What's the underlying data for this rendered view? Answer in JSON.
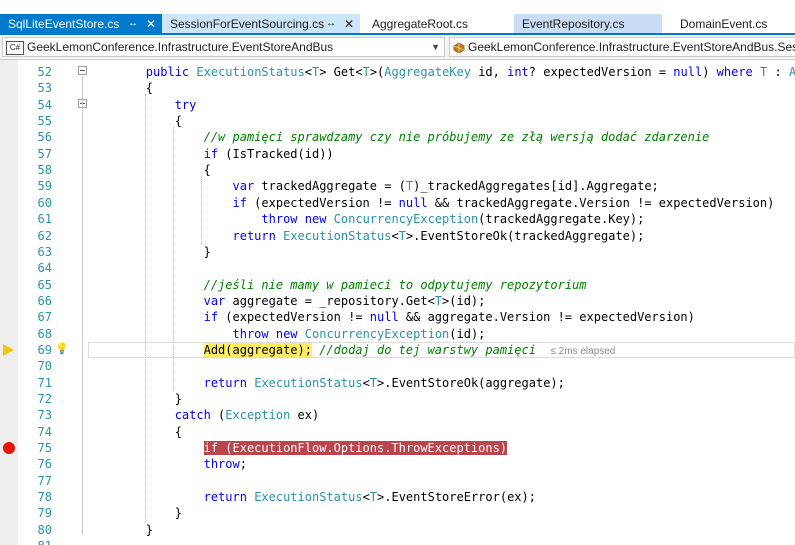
{
  "tabs": [
    {
      "label": "SqlLiteEventStore.cs",
      "pin": "↔",
      "close": "✕"
    },
    {
      "label": "SessionForEventSourcing.cs",
      "pin": "↔",
      "close": "✕"
    },
    {
      "label": "AggregateRoot.cs"
    },
    {
      "label": "EventRepository.cs"
    },
    {
      "label": "DomainEvent.cs"
    }
  ],
  "nav": {
    "project": "GeekLemonConference.Infrastructure.EventStoreAndBus",
    "project_badge": "C#",
    "type_scope": "GeekLemonConference.Infrastructure.EventStoreAndBus.Sessio"
  },
  "elapsed": "≤ 2ms elapsed",
  "lines": [
    {
      "n": "52",
      "html": "        <span class=\"kw\">public</span> <span class=\"ty\">ExecutionStatus</span>&lt;<span class=\"ty\">T</span>&gt; Get&lt;<span class=\"ty\">T</span>&gt;(<span class=\"ty\">AggregateKey</span> id, <span class=\"kw\">int</span>? expectedVersion = <span class=\"kw\">null</span>) <span class=\"kw\">where</span> <span class=\"ty\">T</span> : <span class=\"ty\">Aggreg</span>"
    },
    {
      "n": "53",
      "html": "        {"
    },
    {
      "n": "54",
      "html": "            <span class=\"kw\">try</span>"
    },
    {
      "n": "55",
      "html": "            {"
    },
    {
      "n": "56",
      "html": "                <span class=\"cm\">//w pamięci sprawdzamy czy nie próbujemy ze złą wersją dodać zdarzenie</span>"
    },
    {
      "n": "57",
      "html": "                <span class=\"kw\">if</span> (IsTracked(id))"
    },
    {
      "n": "58",
      "html": "                {"
    },
    {
      "n": "59",
      "html": "                    <span class=\"kw\">var</span> trackedAggregate = (<span class=\"ty\">T</span>)_trackedAggregates[id].Aggregate;"
    },
    {
      "n": "60",
      "html": "                    <span class=\"kw\">if</span> (expectedVersion != <span class=\"kw\">null</span> &amp;&amp; trackedAggregate.Version != expectedVersion)"
    },
    {
      "n": "61",
      "html": "                        <span class=\"kw\">throw</span> <span class=\"kw\">new</span> <span class=\"ty\">ConcurrencyException</span>(trackedAggregate.Key);"
    },
    {
      "n": "62",
      "html": "                    <span class=\"kw\">return</span> <span class=\"ty\">ExecutionStatus</span>&lt;<span class=\"ty\">T</span>&gt;.EventStoreOk(trackedAggregate);"
    },
    {
      "n": "63",
      "html": "                }"
    },
    {
      "n": "64",
      "html": ""
    },
    {
      "n": "65",
      "html": "                <span class=\"cm\">//jeśli nie mamy w pamieci to odpytujemy repozytorium</span>"
    },
    {
      "n": "66",
      "html": "                <span class=\"kw\">var</span> aggregate = _repository.Get&lt;<span class=\"ty\">T</span>&gt;(id);"
    },
    {
      "n": "67",
      "html": "                <span class=\"kw\">if</span> (expectedVersion != <span class=\"kw\">null</span> &amp;&amp; aggregate.Version != expectedVersion)"
    },
    {
      "n": "68",
      "html": "                    <span class=\"kw\">throw</span> <span class=\"kw\">new</span> <span class=\"ty\">ConcurrencyException</span>(id);"
    },
    {
      "n": "69",
      "html": "                <span class=\"cur-line\">Add(aggregate);</span> <span class=\"cm\">//dodaj do tej warstwy pamięci</span>  <span class=\"elapsed\">≤ 2ms elapsed</span>"
    },
    {
      "n": "70",
      "html": ""
    },
    {
      "n": "71",
      "html": "                <span class=\"kw\">return</span> <span class=\"ty\">ExecutionStatus</span>&lt;<span class=\"ty\">T</span>&gt;.EventStoreOk(aggregate);"
    },
    {
      "n": "72",
      "html": "            }"
    },
    {
      "n": "73",
      "html": "            <span class=\"kw\">catch</span> (<span class=\"ty\">Exception</span> ex)"
    },
    {
      "n": "74",
      "html": "            {"
    },
    {
      "n": "75",
      "html": "                <span class=\"bp-line\">if (ExecutionFlow.Options.ThrowExceptions)</span>"
    },
    {
      "n": "76",
      "html": "                <span class=\"kw\">throw</span>;"
    },
    {
      "n": "77",
      "html": ""
    },
    {
      "n": "78",
      "html": "                <span class=\"kw\">return</span> <span class=\"ty\">ExecutionStatus</span>&lt;<span class=\"ty\">T</span>&gt;.EventStoreError(ex);"
    },
    {
      "n": "79",
      "html": "            }"
    },
    {
      "n": "80",
      "html": "        }"
    },
    {
      "n": "81",
      "html": ""
    }
  ],
  "colors": {
    "accent": "#007acc",
    "keyword": "#0000ff",
    "type": "#2b91af",
    "comment": "#008000",
    "breakpoint": "#e51400"
  }
}
